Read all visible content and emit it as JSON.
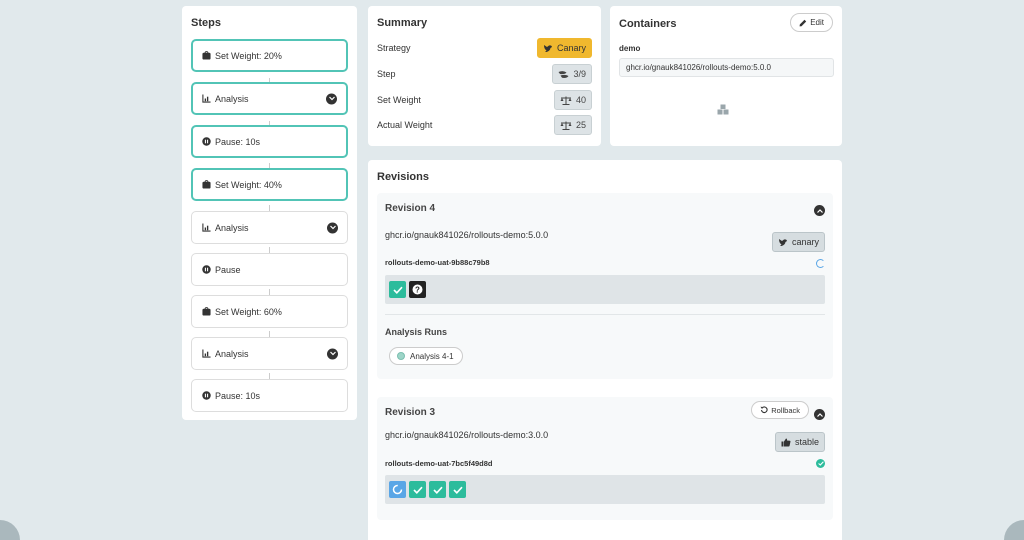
{
  "steps": {
    "title": "Steps",
    "items": [
      {
        "label": "Set Weight: 20%",
        "icon": "weight-icon",
        "active": true,
        "expandable": false
      },
      {
        "label": "Analysis",
        "icon": "chart-icon",
        "active": true,
        "expandable": true
      },
      {
        "label": "Pause: 10s",
        "icon": "pause-icon",
        "active": true,
        "expandable": false
      },
      {
        "label": "Set Weight: 40%",
        "icon": "weight-icon",
        "active": true,
        "expandable": false
      },
      {
        "label": "Analysis",
        "icon": "chart-icon",
        "active": false,
        "expandable": true
      },
      {
        "label": "Pause",
        "icon": "pause-icon",
        "active": false,
        "expandable": false
      },
      {
        "label": "Set Weight: 60%",
        "icon": "weight-icon",
        "active": false,
        "expandable": false
      },
      {
        "label": "Analysis",
        "icon": "chart-icon",
        "active": false,
        "expandable": true
      },
      {
        "label": "Pause: 10s",
        "icon": "pause-icon",
        "active": false,
        "expandable": false
      }
    ]
  },
  "summary": {
    "title": "Summary",
    "rows": [
      {
        "label": "Strategy",
        "value": "Canary"
      },
      {
        "label": "Step",
        "value": "3/9"
      },
      {
        "label": "Set Weight",
        "value": "40"
      },
      {
        "label": "Actual Weight",
        "value": "25"
      }
    ]
  },
  "containers": {
    "title": "Containers",
    "edit_label": "Edit",
    "name": "demo",
    "image": "ghcr.io/gnauk841026/rollouts-demo:5.0.0"
  },
  "revisions": {
    "title": "Revisions",
    "items": [
      {
        "title": "Revision 4",
        "image": "ghcr.io/gnauk841026/rollouts-demo:5.0.0",
        "tag": "canary",
        "replicaset": "rollouts-demo-uat-9b88c79b8",
        "status": "progressing",
        "pods": [
          "ok",
          "unknown"
        ],
        "analysis_title": "Analysis Runs",
        "analysis_runs": [
          "Analysis 4-1"
        ]
      },
      {
        "title": "Revision 3",
        "rollback_label": "Rollback",
        "image": "ghcr.io/gnauk841026/rollouts-demo:3.0.0",
        "tag": "stable",
        "replicaset": "rollouts-demo-uat-7bc5f49d8d",
        "status": "healthy",
        "pods": [
          "progress",
          "ok",
          "ok",
          "ok"
        ]
      }
    ]
  },
  "colors": {
    "accent": "#52c4b6",
    "canary": "#f0b82e",
    "pod_ok": "#2dbc9c",
    "background": "#e1e9ec"
  }
}
